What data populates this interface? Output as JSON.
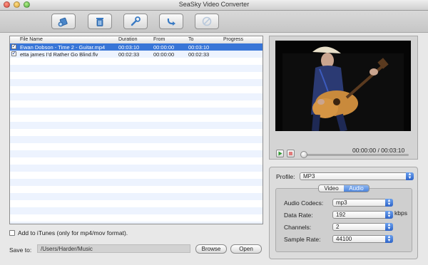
{
  "window": {
    "title": "SeaSky Video Converter"
  },
  "table": {
    "columns": [
      "File Name",
      "Duration",
      "From",
      "To",
      "Progress"
    ],
    "rows": [
      {
        "name": "Ewan Dobson - Time 2 - Guitar.mp4",
        "duration": "00:03:10",
        "from": "00:00:00",
        "to": "00:03:10",
        "progress": "",
        "checked": true,
        "selected": true
      },
      {
        "name": "etta james I'd Rather Go Blind.flv",
        "duration": "00:02:33",
        "from": "00:00:00",
        "to": "00:02:33",
        "progress": "",
        "checked": true,
        "selected": false
      }
    ]
  },
  "itunes": {
    "label": "Add to iTunes (only for mp4/mov format)."
  },
  "save": {
    "label": "Save to:",
    "path": "/Users/Harder/Music",
    "browse": "Browse",
    "open": "Open"
  },
  "player": {
    "timecode": "00:00:00  /  00:03:10",
    "position": 0.0
  },
  "profile": {
    "label": "Profile:",
    "value": "MP3"
  },
  "tabs": {
    "video": "Video",
    "audio": "Audio",
    "active": "audio"
  },
  "audio": {
    "codecs_label": "Audio Codecs:",
    "codecs_value": "mp3",
    "rate_label": "Data Rate:",
    "rate_value": "192",
    "rate_unit": "kbps",
    "channels_label": "Channels:",
    "channels_value": "2",
    "sample_label": "Sample Rate:",
    "sample_value": "44100"
  },
  "icons": [
    "add-file-icon",
    "delete-icon",
    "settings-wrench-icon",
    "convert-arrow-icon",
    "stop-icon"
  ]
}
